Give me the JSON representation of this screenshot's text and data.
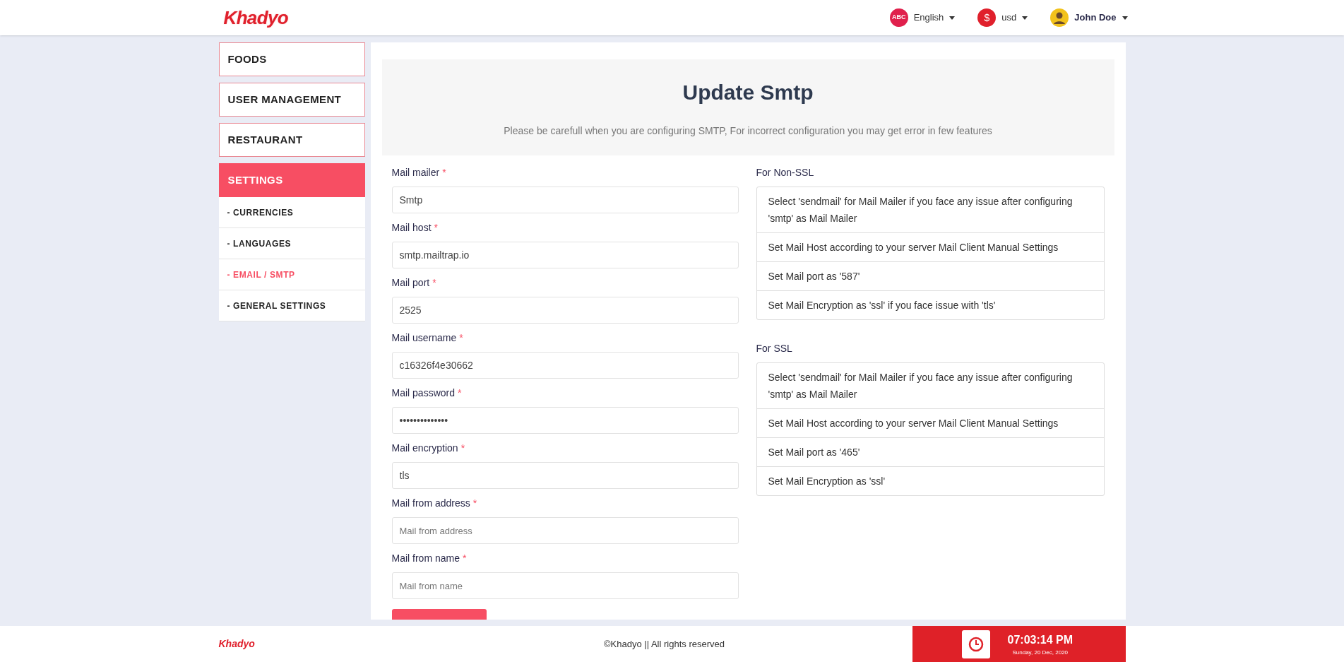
{
  "header": {
    "logo": "Khadyo",
    "language": {
      "badge": "ABC",
      "label": "English"
    },
    "currency": {
      "badge": "$",
      "label": "usd"
    },
    "user": {
      "name": "John Doe"
    }
  },
  "sidebar": {
    "items": [
      {
        "label": "FOODS",
        "selected": false
      },
      {
        "label": "USER MANAGEMENT",
        "selected": false
      },
      {
        "label": "RESTAURANT",
        "selected": false
      },
      {
        "label": "SETTINGS",
        "selected": true,
        "children": [
          {
            "label": "- CURRENCIES",
            "selected": false
          },
          {
            "label": "- LANGUAGES",
            "selected": false
          },
          {
            "label": "- EMAIL / SMTP",
            "selected": true
          },
          {
            "label": "- GENERAL SETTINGS",
            "selected": false
          }
        ]
      }
    ]
  },
  "main": {
    "title": "Update Smtp",
    "subtitle": "Please be carefull when you are configuring SMTP, For incorrect configuration you may get error in few features",
    "fields": [
      {
        "label": "Mail mailer",
        "asterisk": "*",
        "value": "Smtp"
      },
      {
        "label": "Mail host",
        "asterisk": "*",
        "value": "smtp.mailtrap.io"
      },
      {
        "label": "Mail port",
        "asterisk": "*",
        "value": "2525"
      },
      {
        "label": "Mail username",
        "asterisk": "*",
        "value": "c16326f4e30662"
      },
      {
        "label": "Mail password",
        "asterisk": "*",
        "value": "••••••••••••••"
      },
      {
        "label": "Mail encryption",
        "asterisk": "*",
        "value": "tls"
      },
      {
        "label": "Mail from address",
        "asterisk": "*",
        "placeholder": "Mail from address"
      },
      {
        "label": "Mail from name",
        "asterisk": "*",
        "placeholder": "Mail from name"
      }
    ],
    "hints": [
      {
        "title": "For Non-SSL",
        "items": [
          "Select 'sendmail' for Mail Mailer if you face any issue after configuring 'smtp' as Mail Mailer",
          "Set Mail Host according to your server Mail Client Manual Settings",
          "Set Mail port as '587'",
          "Set Mail Encryption as 'ssl' if you face issue with 'tls'"
        ]
      },
      {
        "title": "For SSL",
        "items": [
          "Select 'sendmail' for Mail Mailer if you face any issue after configuring 'smtp' as Mail Mailer",
          "Set Mail Host according to your server Mail Client Manual Settings",
          "Set Mail port as '465'",
          "Set Mail Encryption as 'ssl'"
        ]
      }
    ]
  },
  "footer": {
    "logo": "Khadyo",
    "copyright": "©Khadyo || All rights reserved",
    "time": "07:03:14 PM",
    "date": "Sunday, 20 Dec, 2020"
  }
}
